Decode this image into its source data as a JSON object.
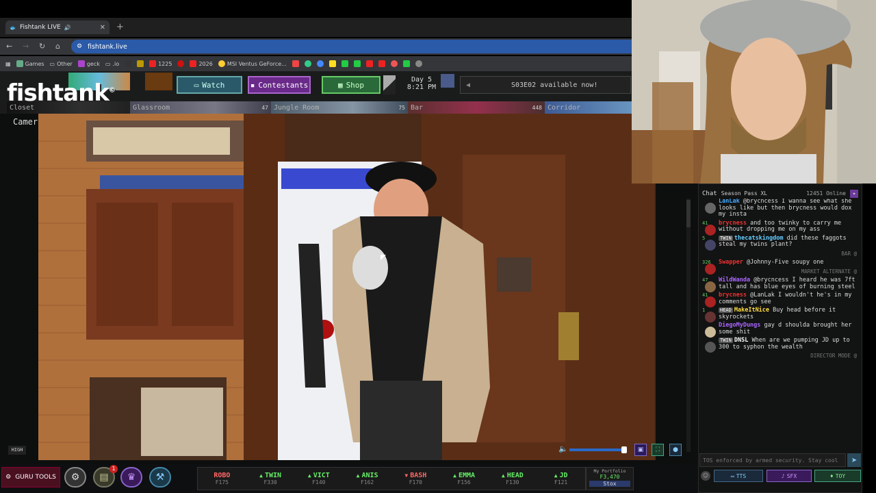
{
  "browser": {
    "tab_title": "Fishtank LIVE",
    "url": "fishtank.live",
    "bookmarks": [
      "Games",
      "Other",
      "geck",
      ".io",
      "1225",
      "2026",
      "MSI Ventus GeForce..."
    ]
  },
  "site": {
    "logo": "fishtank",
    "logo_mark": "©",
    "nav": {
      "watch": "Watch",
      "contestants": "Contestants",
      "shop": "Shop"
    },
    "day": "Day 5",
    "time": "8:21 PM",
    "announcement": "S03E02 available now!",
    "rooms": [
      {
        "name": "Closet",
        "count": ""
      },
      {
        "name": "Glassroom",
        "count": "47"
      },
      {
        "name": "Jungle Room",
        "count": "75"
      },
      {
        "name": "Bar",
        "count": "448"
      },
      {
        "name": "Corridor",
        "count": ""
      }
    ],
    "camera_label": "Cameraman",
    "quality_badge": "HIGH",
    "volume_level": 0.95
  },
  "chat": {
    "tab": "Chat",
    "season_pass": "Season Pass XL",
    "online": "12451 Online",
    "messages": [
      {
        "lvl": "",
        "user": "LanLak",
        "text": "@brycncess I wanna see what she looks like but then brycness would dox my insta",
        "color": "#4af",
        "av": "#666"
      },
      {
        "lvl": "41",
        "user": "brycness",
        "text": "and too twinky to carry me without dropping me on my ass",
        "color": "#e33",
        "av": "#a22"
      },
      {
        "lvl": "5",
        "tag": "TWIN",
        "user": "thecatskingdom",
        "text": "did these faggots steal my twins plant?",
        "color": "#6cf",
        "av": "#446"
      },
      {
        "sys": "BAR @"
      },
      {
        "lvl": "326",
        "user": "Swapper",
        "text": "@Johnny-Five soupy one",
        "color": "#e33",
        "av": "#a22"
      },
      {
        "sys": "MARKET ALTERNATE @"
      },
      {
        "lvl": "47",
        "user": "WildWanda",
        "text": "@brycncess I heard he was 7ft tall and has blue eyes of burning steel",
        "color": "#a6f",
        "av": "#864"
      },
      {
        "lvl": "41",
        "user": "brycness",
        "text": "@LanLak I wouldn't he's in my comments go see",
        "color": "#e33",
        "av": "#a22"
      },
      {
        "lvl": "1",
        "tag": "HEAD",
        "user": "MakeItNice",
        "text": "Buy head before it skyrockets",
        "color": "#fd4",
        "av": "#633"
      },
      {
        "lvl": "",
        "user": "DiegoMyDungs",
        "text": "gay d shoulda brought her some shit",
        "color": "#a6f",
        "av": "#cb9"
      },
      {
        "lvl": "",
        "tag": "TWIN",
        "user": "DNSL",
        "text": "When are we pumping JD up to 300 to syphon the wealth",
        "color": "#fff",
        "av": "#555"
      },
      {
        "sys": "DIRECTOR MODE @"
      }
    ],
    "input_placeholder": "TOS enforced by armed security. Stay cool",
    "buttons": {
      "tts": "TTS",
      "sfx": "SFX",
      "toy": "TOY"
    }
  },
  "bottom": {
    "guru_tools": "GURU TOOLS",
    "notify_count": "1",
    "ticker": [
      {
        "name": "ROBO",
        "price": "F175",
        "dir": "",
        "color": "#f66"
      },
      {
        "name": "TWIN",
        "price": "F330",
        "dir": "up",
        "color": "#6e6"
      },
      {
        "name": "VICT",
        "price": "F140",
        "dir": "up",
        "color": "#6e6"
      },
      {
        "name": "ANIS",
        "price": "F162",
        "dir": "up",
        "color": "#6e6"
      },
      {
        "name": "BASH",
        "price": "F170",
        "dir": "down",
        "color": "#f66"
      },
      {
        "name": "EMMA",
        "price": "F156",
        "dir": "up",
        "color": "#6e6"
      },
      {
        "name": "HEAD",
        "price": "F130",
        "dir": "up",
        "color": "#6e6"
      },
      {
        "name": "JD",
        "price": "F121",
        "dir": "up",
        "color": "#6e6"
      }
    ],
    "portfolio_label": "My Portfolio",
    "portfolio_value": "F3,470",
    "stox": "Stox"
  }
}
